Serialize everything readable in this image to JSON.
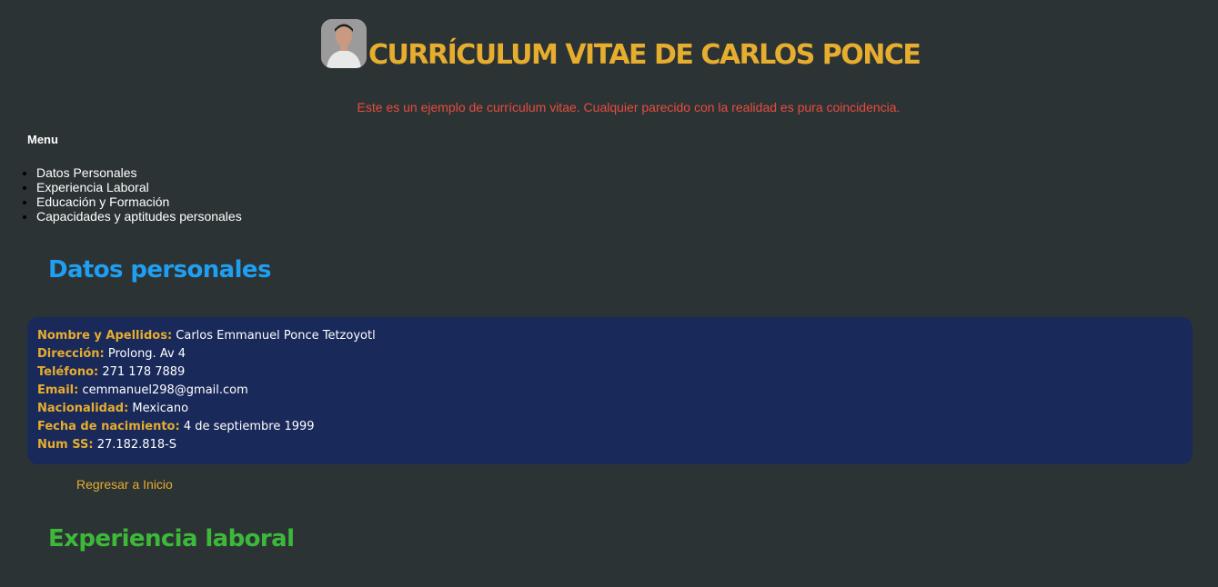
{
  "header": {
    "title": "CURRÍCULUM VITAE DE CARLOS PONCE",
    "disclaimer": "Este es un ejemplo de currículum vitae. Cualquier parecido con la realidad es pura coincidencia."
  },
  "menu": {
    "title": "Menu",
    "items": [
      {
        "label": "Datos Personales"
      },
      {
        "label": "Experiencia Laboral"
      },
      {
        "label": "Educación y Formación"
      },
      {
        "label": "Capacidades y aptitudes personales"
      }
    ]
  },
  "personal": {
    "heading": "Datos personales",
    "fields": [
      {
        "label": "Nombre y Apellidos:",
        "value": "Carlos Emmanuel Ponce Tetzoyotl"
      },
      {
        "label": "Dirección:",
        "value": "Prolong. Av 4"
      },
      {
        "label": "Teléfono:",
        "value": "271 178 7889"
      },
      {
        "label": "Email:",
        "value": "cemmanuel298@gmail.com"
      },
      {
        "label": "Nacionalidad:",
        "value": "Mexicano"
      },
      {
        "label": "Fecha de nacimiento:",
        "value": "4 de septiembre 1999"
      },
      {
        "label": "Num SS:",
        "value": "27.182.818-S"
      }
    ],
    "back_link": "Regresar a Inicio"
  },
  "work": {
    "heading": "Experiencia laboral"
  },
  "colors": {
    "background": "#2c3335",
    "title_gold": "#e6ad2e",
    "disclaimer_red": "#e84c3d",
    "personal_blue": "#1e9ff2",
    "work_green": "#3db93a",
    "card_navy": "#19295a"
  }
}
